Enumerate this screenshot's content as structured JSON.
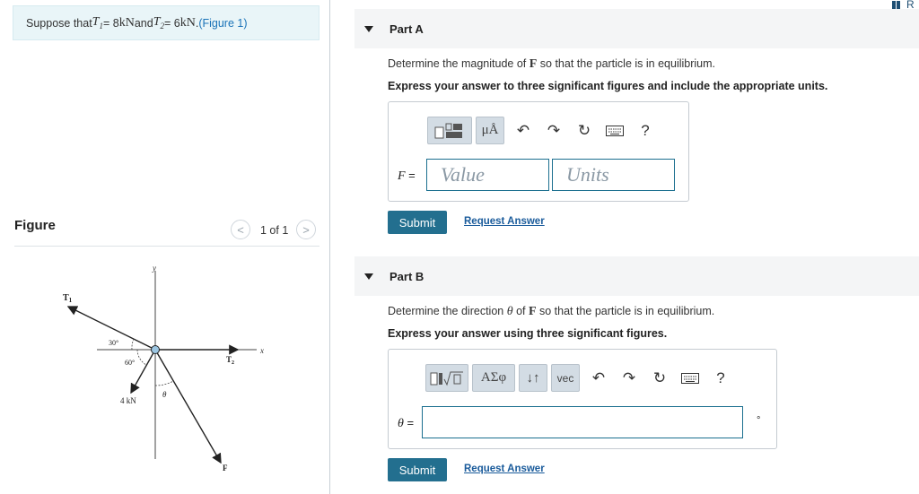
{
  "problem": {
    "intro_prefix": "Suppose that ",
    "t1_var": "T",
    "t1_sub": "1",
    "t1_value": " = 8 ",
    "t1_unit": "kN",
    "and": " and ",
    "t2_var": "T",
    "t2_sub": "2",
    "t2_value": " = 6 ",
    "t2_unit": "kN",
    "period": " . ",
    "figure_link": "(Figure 1)"
  },
  "figure": {
    "title": "Figure",
    "pager_prev": "<",
    "pager_next": ">",
    "pager_text": "1 of 1",
    "labels": {
      "y_axis": "y",
      "x_axis": "x",
      "t1": "T",
      "t1_sub": "1",
      "t2": "T",
      "t2_sub": "2",
      "f": "F",
      "angle_30": "30°",
      "angle_60": "60°",
      "force_4kn": "4 kN",
      "theta": "θ"
    }
  },
  "part_a": {
    "title": "Part A",
    "prompt_before": "Determine the magnitude of ",
    "prompt_bold": "F",
    "prompt_after": " so that the particle is in equilibrium.",
    "instruction": "Express your answer to three significant figures and include the appropriate units.",
    "field_label_var": "F",
    "field_label_eq": " =",
    "value_placeholder": "Value",
    "units_placeholder": "Units",
    "toolbar": {
      "template_icon": "template-icon",
      "units_btn": "μÅ",
      "help": "?"
    },
    "submit": "Submit",
    "request": "Request Answer"
  },
  "part_b": {
    "title": "Part B",
    "prompt_before": "Determine the direction ",
    "prompt_theta": "θ",
    "prompt_mid": " of ",
    "prompt_bold": "F",
    "prompt_after": " so that the particle is in equilibrium.",
    "instruction": "Express your answer using three significant figures.",
    "field_label_var": "θ",
    "field_label_eq": " =",
    "unit_symbol": "°",
    "toolbar": {
      "greek_btn": "ΑΣφ",
      "arrows_btn": "↓↑",
      "vec_btn": "vec",
      "help": "?"
    },
    "submit": "Submit",
    "request": "Request Answer"
  },
  "corner": {
    "text": "R"
  },
  "colors": {
    "accent": "#236f8f",
    "link": "#1a73b8",
    "intro_bg": "#e9f5f8",
    "toolbar_btn": "#d3dce4"
  }
}
